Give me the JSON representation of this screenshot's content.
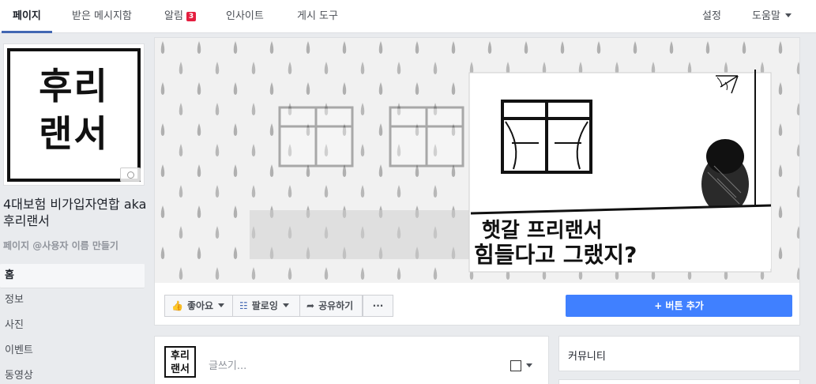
{
  "topnav": {
    "tabs": [
      {
        "label": "페이지"
      },
      {
        "label": "받은 메시지함"
      },
      {
        "label": "알림",
        "badge": "3"
      },
      {
        "label": "인사이트"
      },
      {
        "label": "게시 도구"
      }
    ],
    "settings": "설정",
    "help": "도움말"
  },
  "profile": {
    "logo_line1": "후리",
    "logo_line2": "랜서",
    "name": "4대보험 비가입자연합 aka 후리랜서",
    "username_link": "페이지 @사용자 이름 만들기"
  },
  "sidebar": {
    "items": [
      {
        "label": "홈"
      },
      {
        "label": "정보"
      },
      {
        "label": "사진"
      },
      {
        "label": "이벤트"
      },
      {
        "label": "동영상"
      }
    ]
  },
  "cover": {
    "caption_line1": "햇갈 프리랜서",
    "caption_line2": "힘들다고 그랬지?"
  },
  "actions": {
    "like": "좋아요",
    "follow": "팔로잉",
    "share": "공유하기",
    "more": "···",
    "add_button": "+ 버튼 추가"
  },
  "composer": {
    "placeholder": "글쓰기..."
  },
  "community": {
    "title": "커뮤니티"
  },
  "colors": {
    "accent": "#4267b2",
    "primary_button": "#4080ff",
    "badge": "#e41e3f"
  }
}
